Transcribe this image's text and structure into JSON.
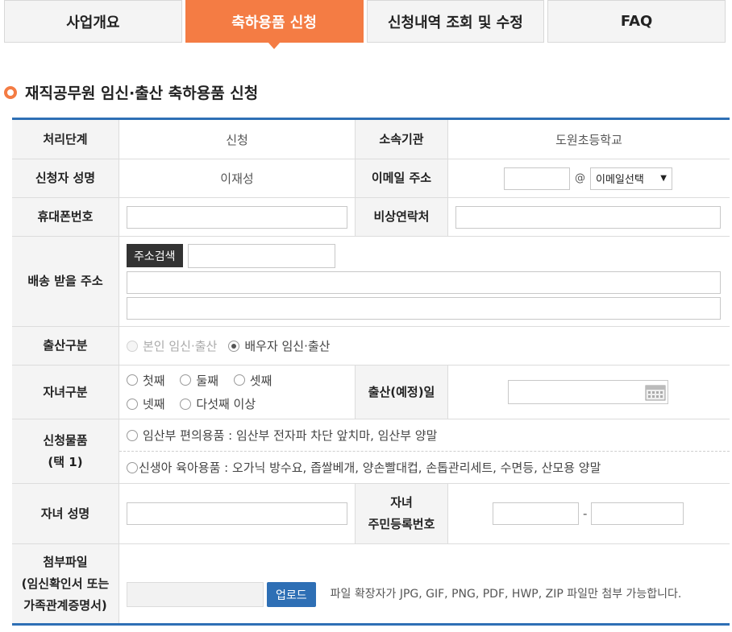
{
  "tabs": [
    {
      "label": "사업개요"
    },
    {
      "label": "축하용품 신청"
    },
    {
      "label": "신청내역 조회 및 수정"
    },
    {
      "label": "FAQ"
    }
  ],
  "section_title": "재직공무원 임신·출산 축하용품 신청",
  "form": {
    "stage_label": "처리단계",
    "stage_value": "신청",
    "org_label": "소속기관",
    "org_value": "도원초등학교",
    "applicant_label": "신청자 성명",
    "applicant_value": "이재성",
    "email_label": "이메일 주소",
    "email_at": "@",
    "email_select": "이메일선택",
    "mobile_label": "휴대폰번호",
    "emergency_label": "비상연락처",
    "address_label": "배송 받을 주소",
    "address_search": "주소검색",
    "birth_type_label": "출산구분",
    "birth_type_options": [
      "본인 임신·출산",
      "배우자 임신·출산"
    ],
    "child_order_label": "자녀구분",
    "child_order_options": [
      "첫째",
      "둘째",
      "셋째",
      "넷째",
      "다섯째 이상"
    ],
    "due_date_label": "출산(예정)일",
    "item_label_1": "신청물품",
    "item_label_2": "(택 1)",
    "item_options": [
      "임산부 편의용품 : 임산부 전자파 차단 앞치마, 임산부 양말",
      "신생아 육아용품 : 오가닉 방수요, 좁쌀베개, 양손빨대컵, 손톱관리세트, 수면등, 산모용 양말"
    ],
    "child_name_label": "자녀 성명",
    "child_rrn_label_1": "자녀",
    "child_rrn_label_2": "주민등록번호",
    "rrn_dash": "-",
    "attach_label_1": "첨부파일",
    "attach_label_2": "(임신확인서 또는",
    "attach_label_3": "가족관계증명서)",
    "upload_button": "업로드",
    "attach_note": "파일 확장자가 JPG, GIF, PNG, PDF, HWP, ZIP 파일만 첨부 가능합니다."
  },
  "colors": {
    "accent": "#f47c44",
    "primary": "#2e6fb5"
  },
  "icons": {
    "select_arrow": "chevron-down-icon",
    "calendar": "calendar-icon"
  }
}
